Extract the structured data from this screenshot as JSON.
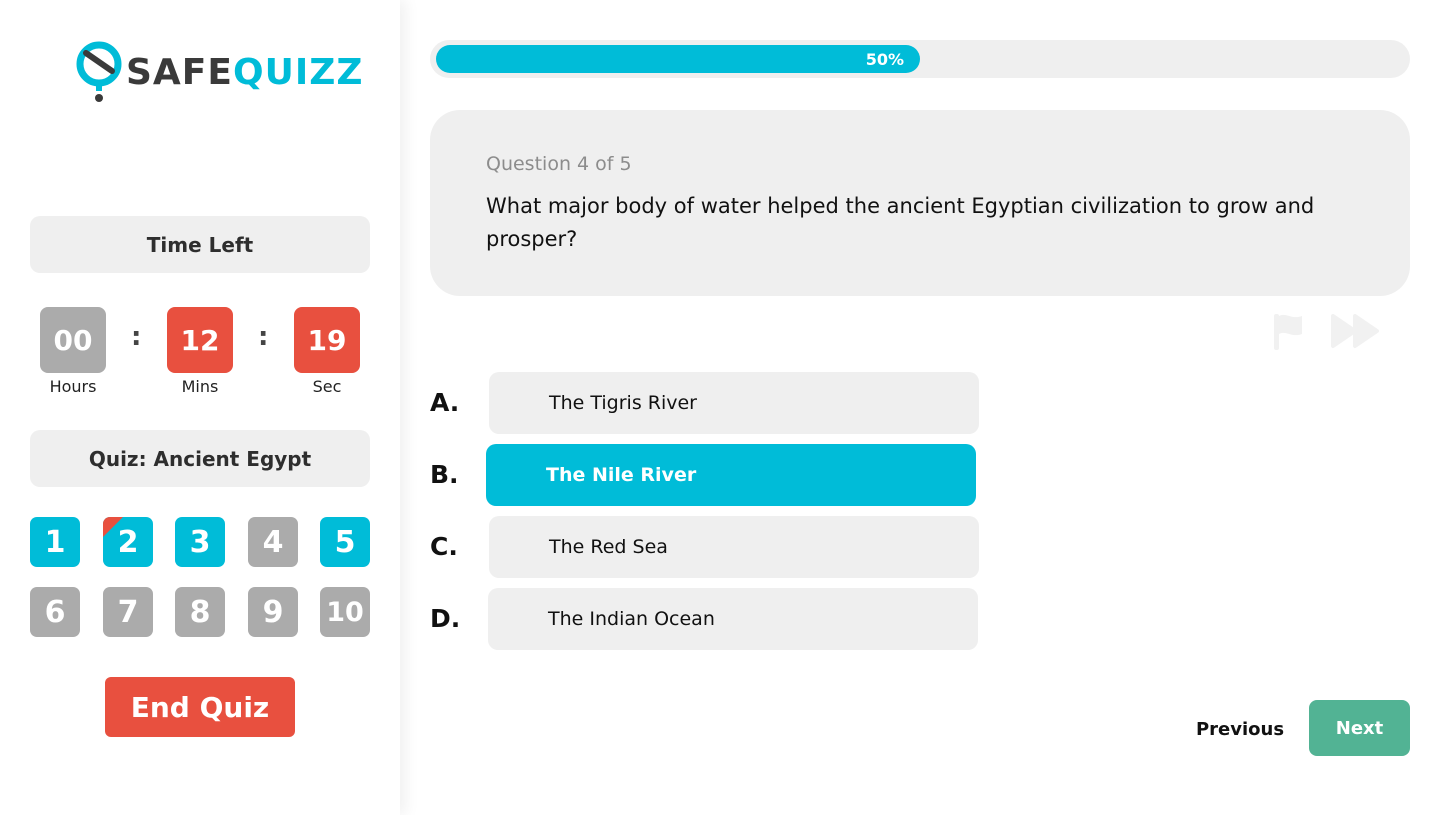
{
  "brand": {
    "name_part1": "SAFE",
    "name_part2": "QUIZZ"
  },
  "colors": {
    "accent": "#00bcd8",
    "danger": "#e8503f",
    "muted": "#ababab",
    "success": "#52b394",
    "panel": "#efefef"
  },
  "timer": {
    "title": "Time Left",
    "hours": "00",
    "hours_label": "Hours",
    "mins": "12",
    "mins_label": "Mins",
    "secs": "19",
    "secs_label": "Sec",
    "separator": ":"
  },
  "quiz": {
    "title": "Quiz: Ancient Egypt",
    "question_numbers": [
      "1",
      "2",
      "3",
      "4",
      "5",
      "6",
      "7",
      "8",
      "9",
      "10"
    ],
    "end_label": "End Quiz"
  },
  "progress": {
    "value": 0.5,
    "label": "50%"
  },
  "question": {
    "counter": "Question 4 of 5",
    "text": "What major body of water helped the ancient Egyptian civilization to grow and prosper?"
  },
  "action_icons": [
    "flag-icon",
    "skip-forward-icon"
  ],
  "options": [
    {
      "letter": "A.",
      "text": "The Tigris River"
    },
    {
      "letter": "B.",
      "text": "The Nile River",
      "selected": true
    },
    {
      "letter": "C.",
      "text": "The Red Sea"
    },
    {
      "letter": "D.",
      "text": "The Indian Ocean"
    }
  ],
  "nav": {
    "previous_label": "Previous",
    "next_label": "Next"
  }
}
